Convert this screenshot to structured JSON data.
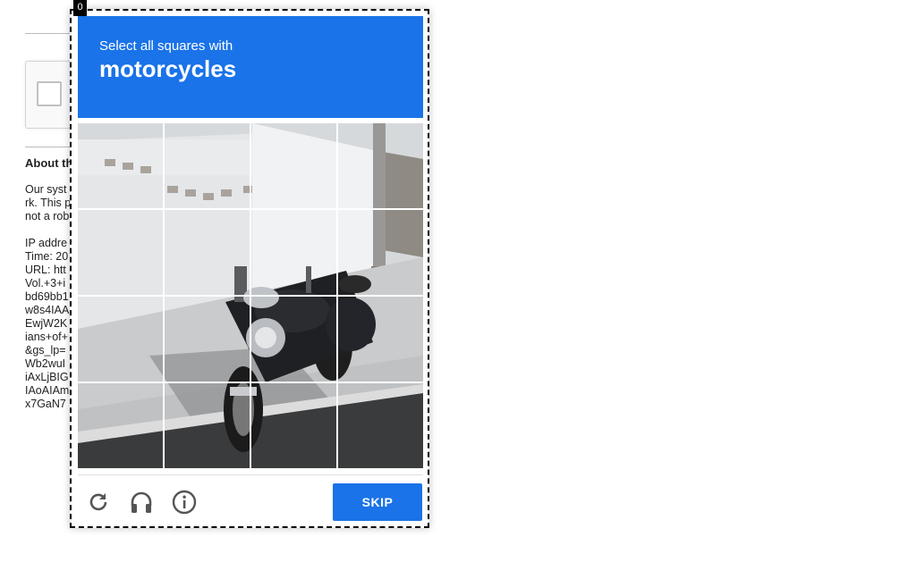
{
  "page": {
    "about_label": "About th",
    "para1": [
      "Our syst",
      "rk. This p",
      "not a rob"
    ],
    "para2": [
      "IP addre",
      "Time: 20",
      "URL: htt",
      "Vol.+3+i",
      "bd69bb1",
      "w8s4IAA",
      "EwjW2K",
      "ians+of+",
      "&gs_lp=",
      "Wb2wuI",
      "iAxLjBIG",
      "IAoAIAm",
      "x7GaN7"
    ]
  },
  "challenge": {
    "badge": "0",
    "instruction": "Select all squares with",
    "target": "motorcycles",
    "skip_label": "SKIP",
    "header_color": "#1a73e8",
    "tiles": [
      {
        "row": 0,
        "col": 0
      },
      {
        "row": 0,
        "col": 1
      },
      {
        "row": 0,
        "col": 2
      },
      {
        "row": 0,
        "col": 3
      },
      {
        "row": 1,
        "col": 0
      },
      {
        "row": 1,
        "col": 1
      },
      {
        "row": 1,
        "col": 2
      },
      {
        "row": 1,
        "col": 3
      },
      {
        "row": 2,
        "col": 0
      },
      {
        "row": 2,
        "col": 1
      },
      {
        "row": 2,
        "col": 2
      },
      {
        "row": 2,
        "col": 3
      },
      {
        "row": 3,
        "col": 0
      },
      {
        "row": 3,
        "col": 1
      },
      {
        "row": 3,
        "col": 2
      },
      {
        "row": 3,
        "col": 3
      }
    ],
    "icons": [
      "reload-icon",
      "audio-headphones-icon",
      "info-icon"
    ]
  }
}
